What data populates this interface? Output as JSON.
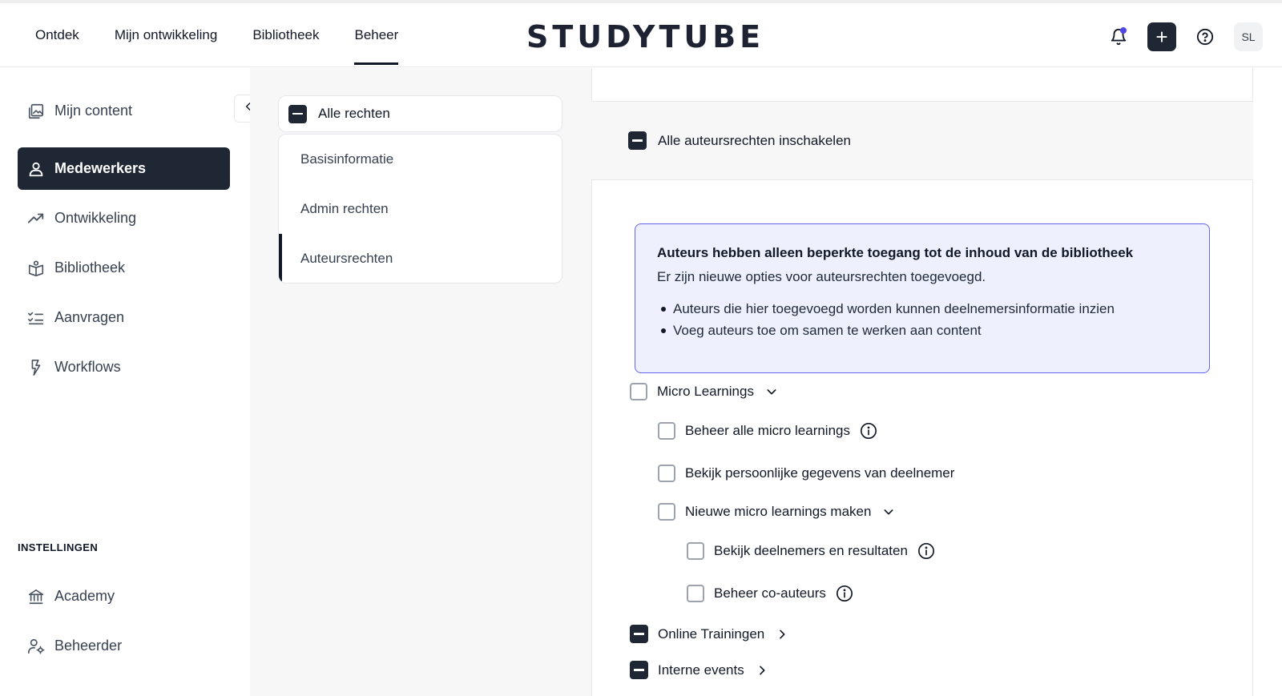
{
  "nav": {
    "items": [
      {
        "label": "Ontdek"
      },
      {
        "label": "Mijn ontwikkeling"
      },
      {
        "label": "Bibliotheek"
      },
      {
        "label": "Beheer"
      }
    ],
    "logo_text": "STUDYTUBE",
    "avatar_initials": "SL",
    "plus_label": "+"
  },
  "sidebar": {
    "items": [
      {
        "label": "Mijn content",
        "icon": "image-stack-icon"
      },
      {
        "label": "Medewerkers",
        "icon": "user-icon",
        "active": true
      },
      {
        "label": "Ontwikkeling",
        "icon": "trend-up-icon"
      },
      {
        "label": "Bibliotheek",
        "icon": "book-user-icon"
      },
      {
        "label": "Aanvragen",
        "icon": "checklist-icon"
      },
      {
        "label": "Workflows",
        "icon": "bolt-icon"
      }
    ],
    "section_label": "INSTELLINGEN",
    "settings": [
      {
        "label": "Academy",
        "icon": "bank-icon"
      },
      {
        "label": "Beheerder",
        "icon": "user-gear-icon"
      }
    ]
  },
  "rights": {
    "all_label": "Alle rechten",
    "tabs": [
      {
        "label": "Basisinformatie"
      },
      {
        "label": "Admin rechten"
      },
      {
        "label": "Auteursrechten",
        "active": true
      }
    ]
  },
  "main": {
    "enable_all_label": "Alle auteursrechten inschakelen",
    "info": {
      "title": "Auteurs hebben alleen beperkte toegang tot de inhoud van de bibliotheek",
      "subtitle": "Er zijn nieuwe opties voor auteursrechten toegevoegd.",
      "bullets": [
        "Auteurs die hier toegevoegd worden kunnen deelnemersinformatie inzien",
        "Voeg auteurs toe om samen te werken aan content"
      ]
    },
    "permissions": {
      "micro": "Micro Learnings",
      "manage_all": "Beheer alle micro learnings",
      "view_personal": "Bekijk persoonlijke gegevens van deelnemer",
      "create_new": "Nieuwe micro learnings maken",
      "view_participants": "Bekijk deelnemers en resultaten",
      "manage_coauthors": "Beheer co-auteurs",
      "online": "Online Trainingen",
      "internal": "Interne events"
    }
  },
  "colors": {
    "dark": "#1e2733",
    "accent": "#6366f1",
    "info_bg": "#eef0fd",
    "notification_dot": "#4f46e5"
  }
}
